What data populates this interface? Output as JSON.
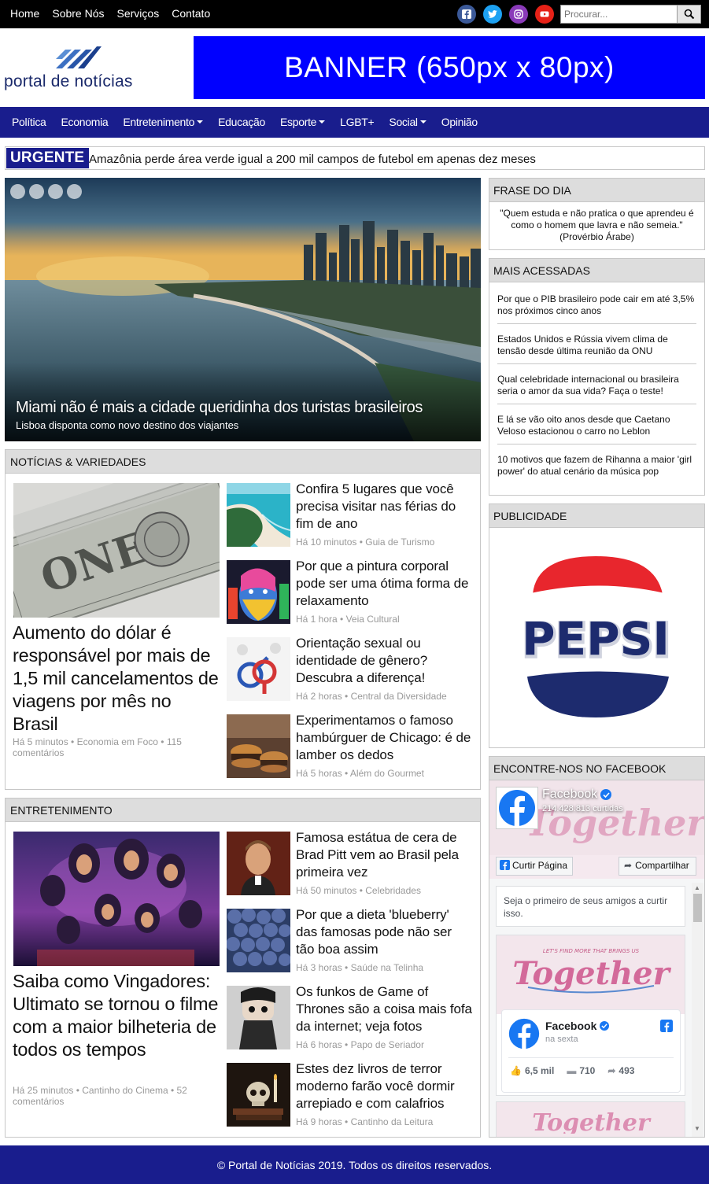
{
  "topnav": {
    "items": [
      "Home",
      "Sobre Nós",
      "Serviços",
      "Contato"
    ]
  },
  "socials": [
    {
      "icon": "facebook-icon",
      "color": "#3b5998"
    },
    {
      "icon": "twitter-icon",
      "color": "#1da1f2"
    },
    {
      "icon": "instagram-icon",
      "color": "#8a3ab9"
    },
    {
      "icon": "youtube-icon",
      "color": "#e62117"
    }
  ],
  "search": {
    "placeholder": "Procurar..."
  },
  "logo": {
    "name": "portal de notícias"
  },
  "banner": {
    "text": "BANNER (650px x 80px)"
  },
  "mainnav": {
    "items": [
      {
        "label": "Política",
        "dropdown": false
      },
      {
        "label": "Economia",
        "dropdown": false
      },
      {
        "label": "Entretenimento",
        "dropdown": true
      },
      {
        "label": "Educação",
        "dropdown": false
      },
      {
        "label": "Esporte",
        "dropdown": true
      },
      {
        "label": "LGBT+",
        "dropdown": false
      },
      {
        "label": "Social",
        "dropdown": true
      },
      {
        "label": "Opinião",
        "dropdown": false
      }
    ]
  },
  "urgent": {
    "tag": "URGENTE",
    "text": "Amazônia perde área verde igual a 200 mil campos de futebol em apenas dez meses"
  },
  "hero": {
    "title": "Miami não é mais a cidade queridinha dos turistas brasileiros",
    "subtitle": "Lisboa disponta como novo destino dos viajantes"
  },
  "noticias": {
    "heading": "NOTÍCIAS & VARIEDADES",
    "main": {
      "title": "Aumento do dólar é responsável por mais de 1,5 mil cancelamentos de viagens por mês no Brasil",
      "meta": "Há 5 minutos • Economia em Foco • 115 comentários"
    },
    "items": [
      {
        "title": "Confira 5 lugares que você precisa visitar nas férias do fim de ano",
        "meta": "Há 10 minutos • Guia de Turismo"
      },
      {
        "title": "Por que a pintura corporal pode ser uma ótima forma de relaxamento",
        "meta": "Há 1 hora • Veia Cultural"
      },
      {
        "title": "Orientação sexual ou identidade de gênero? Descubra a diferença!",
        "meta": "Há 2 horas • Central da Diversidade"
      },
      {
        "title": "Experimentamos o famoso hambúrguer de Chicago: é de lamber os dedos",
        "meta": "Há 5 horas • Além do Gourmet"
      }
    ]
  },
  "entretenimento": {
    "heading": "ENTRETENIMENTO",
    "main": {
      "title": "Saiba como Vingadores: Ultimato se tornou o filme com a maior bilheteria de todos os tempos",
      "meta": "Há 25 minutos • Cantinho do Cinema • 52 comentários"
    },
    "items": [
      {
        "title": "Famosa estátua de cera de Brad Pitt vem ao Brasil pela primeira vez",
        "meta": "Há 50 minutos • Celebridades"
      },
      {
        "title": "Por que a dieta 'blueberry' das famosas pode não ser tão boa assim",
        "meta": "Há 3 horas • Saúde na Telinha"
      },
      {
        "title": "Os funkos de Game of Thrones são a coisa mais fofa da internet; veja fotos",
        "meta": "Há 6 horas • Papo de Seriador"
      },
      {
        "title": "Estes dez livros de terror moderno farão você dormir arrepiado e com calafrios",
        "meta": "Há 9 horas • Cantinho da Leitura"
      }
    ]
  },
  "frase": {
    "heading": "FRASE DO DIA",
    "text": "\"Quem estuda e não pratica o que aprendeu é como o homem que lavra e não semeia.\"",
    "author": "(Provérbio Árabe)"
  },
  "mais": {
    "heading": "MAIS ACESSADAS",
    "items": [
      "Por que o PIB brasileiro pode cair em até 3,5% nos próximos cinco anos",
      "Estados Unidos e Rússia vivem clima de tensão desde última reunião da ONU",
      "Qual celebridade internacional ou brasileira seria o amor da sua vida? Faça o teste!",
      "E lá se vão oito anos desde que Caetano Veloso estacionou o carro no Leblon",
      "10 motivos que fazem de Rihanna a maior 'girl power' do atual cenário da música pop"
    ]
  },
  "publicidade": {
    "heading": "PUBLICIDADE",
    "brand": "PEPSI"
  },
  "facebook": {
    "heading": "ENCONTRE-NOS NO FACEBOOK",
    "page_name": "Facebook",
    "likes": "214.428.813 curtidas",
    "like_button": "Curtir Página",
    "share_button": "Compartilhar",
    "friends_text": "Seja o primeiro de seus amigos a curtir isso.",
    "post_name": "Facebook",
    "post_time": "na sexta",
    "reactions": "6,5 mil",
    "comments": "710",
    "shares": "493",
    "cover_word": "Together",
    "cover_tagline": "LET'S FIND MORE THAT BRINGS US"
  },
  "footer": {
    "text": "© Portal de Notícias 2019. Todos os direitos reservados."
  },
  "colors": {
    "nav": "#191d8d",
    "banner": "#0000ff",
    "header_gray": "#dddddd"
  }
}
